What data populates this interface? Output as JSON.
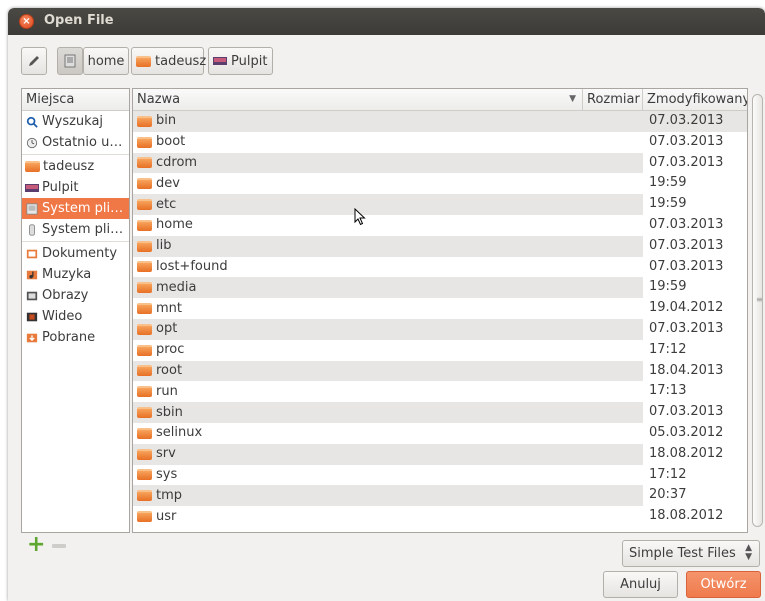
{
  "window": {
    "title": "Open File"
  },
  "pathbar": {
    "buttons": [
      {
        "label": "home"
      },
      {
        "label": "tadeusz"
      },
      {
        "label": "Pulpit"
      }
    ]
  },
  "places": {
    "header": "Miejsca",
    "items": [
      {
        "label": "Wyszukaj",
        "icon": "search-icon"
      },
      {
        "label": "Ostatnio u…",
        "icon": "recent-icon"
      },
      {
        "label": "tadeusz",
        "icon": "home-folder-icon"
      },
      {
        "label": "Pulpit",
        "icon": "desktop-icon"
      },
      {
        "label": "System pli…",
        "icon": "filesystem-icon",
        "selected": true
      },
      {
        "label": "System pli…",
        "icon": "drive-icon"
      },
      {
        "label": "Dokumenty",
        "icon": "documents-icon"
      },
      {
        "label": "Muzyka",
        "icon": "music-icon"
      },
      {
        "label": "Obrazy",
        "icon": "pictures-icon"
      },
      {
        "label": "Wideo",
        "icon": "video-icon"
      },
      {
        "label": "Pobrane",
        "icon": "downloads-icon"
      }
    ]
  },
  "files": {
    "columns": {
      "name": "Nazwa",
      "size": "Rozmiar",
      "modified": "Zmodyfikowany"
    },
    "rows": [
      {
        "name": "bin",
        "size": "",
        "modified": "07.03.2013"
      },
      {
        "name": "boot",
        "size": "",
        "modified": "07.03.2013"
      },
      {
        "name": "cdrom",
        "size": "",
        "modified": "07.03.2013"
      },
      {
        "name": "dev",
        "size": "",
        "modified": "19:59"
      },
      {
        "name": "etc",
        "size": "",
        "modified": "19:59"
      },
      {
        "name": "home",
        "size": "",
        "modified": "07.03.2013"
      },
      {
        "name": "lib",
        "size": "",
        "modified": "07.03.2013"
      },
      {
        "name": "lost+found",
        "size": "",
        "modified": "07.03.2013"
      },
      {
        "name": "media",
        "size": "",
        "modified": "19:59"
      },
      {
        "name": "mnt",
        "size": "",
        "modified": "19.04.2012"
      },
      {
        "name": "opt",
        "size": "",
        "modified": "07.03.2013"
      },
      {
        "name": "proc",
        "size": "",
        "modified": "17:12"
      },
      {
        "name": "root",
        "size": "",
        "modified": "18.04.2013"
      },
      {
        "name": "run",
        "size": "",
        "modified": "17:13"
      },
      {
        "name": "sbin",
        "size": "",
        "modified": "07.03.2013"
      },
      {
        "name": "selinux",
        "size": "",
        "modified": "05.03.2012"
      },
      {
        "name": "srv",
        "size": "",
        "modified": "18.08.2012"
      },
      {
        "name": "sys",
        "size": "",
        "modified": "17:12"
      },
      {
        "name": "tmp",
        "size": "",
        "modified": "20:37"
      },
      {
        "name": "usr",
        "size": "",
        "modified": "18.08.2012"
      }
    ]
  },
  "filter": {
    "selected": "Simple Test Files"
  },
  "actions": {
    "cancel": "Anuluj",
    "open": "Otwórz"
  },
  "colors": {
    "accent": "#f07746",
    "titlebar": "#3c3b37"
  }
}
